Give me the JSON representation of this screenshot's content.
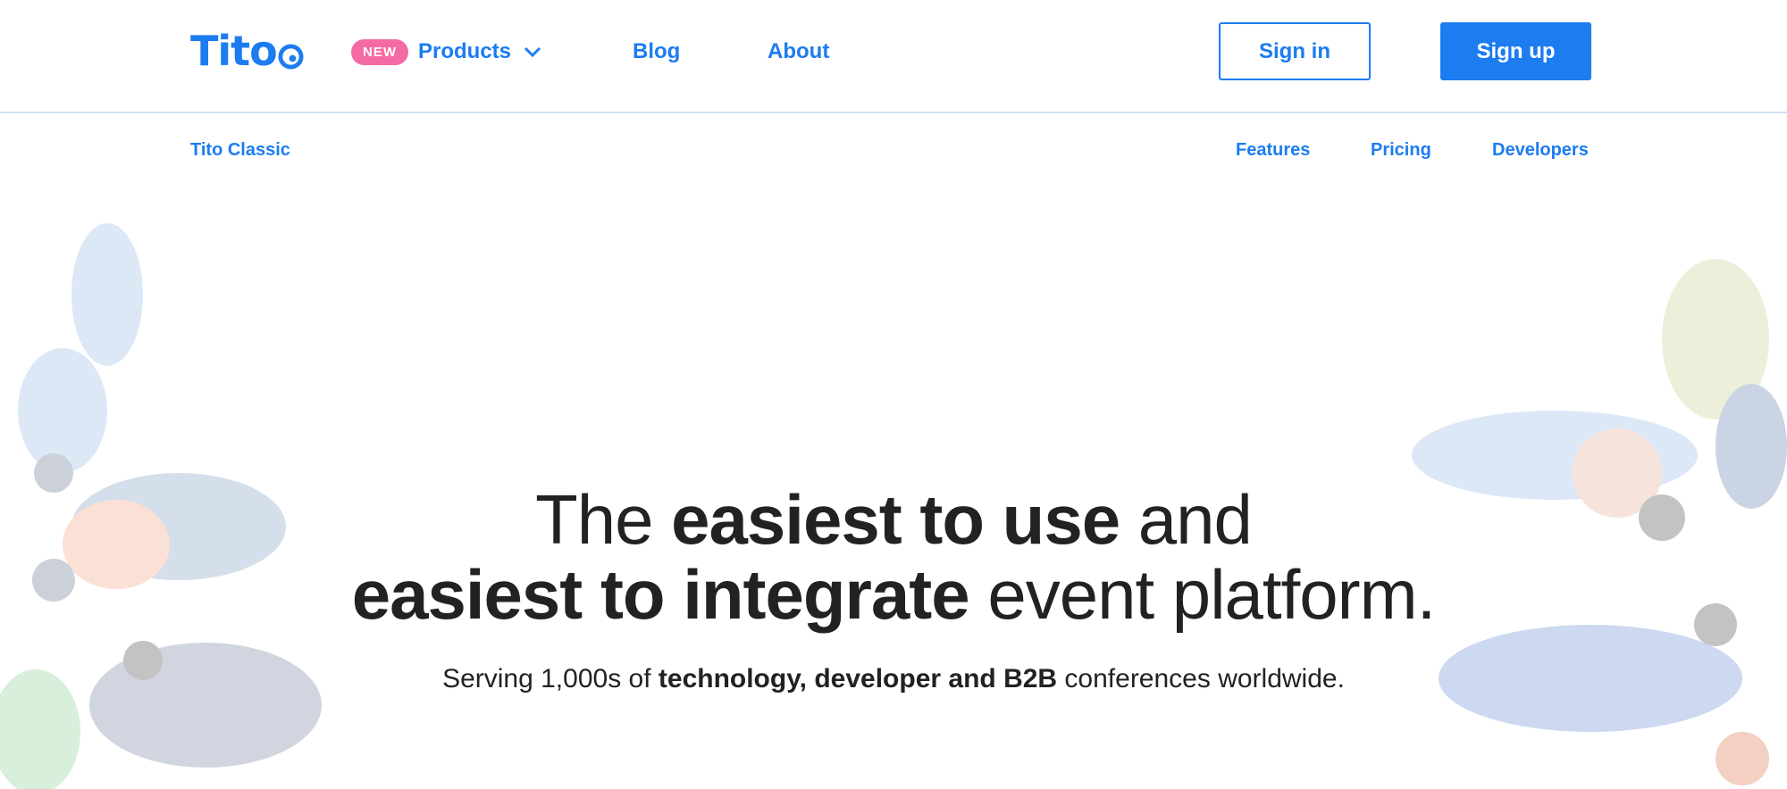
{
  "brand": {
    "name": "Tito",
    "accent": "#1c7cf0",
    "badge_color": "#f36aa4"
  },
  "nav": {
    "badge": "NEW",
    "products": "Products",
    "blog": "Blog",
    "about": "About",
    "sign_in": "Sign in",
    "sign_up": "Sign up"
  },
  "subnav": {
    "classic": "Tito Classic",
    "features": "Features",
    "pricing": "Pricing",
    "developers": "Developers"
  },
  "hero": {
    "line1_a": "The ",
    "line1_b": "easiest to use",
    "line1_c": " and",
    "line2_a": "easiest to integrate",
    "line2_b": " event platform.",
    "sub_a": "Serving 1,000s of ",
    "sub_b": "technology, developer and B2B",
    "sub_c": " conferences worldwide."
  },
  "icons": [
    "chevron-down-icon",
    "logo-swirl-icon",
    "people-illustration"
  ]
}
